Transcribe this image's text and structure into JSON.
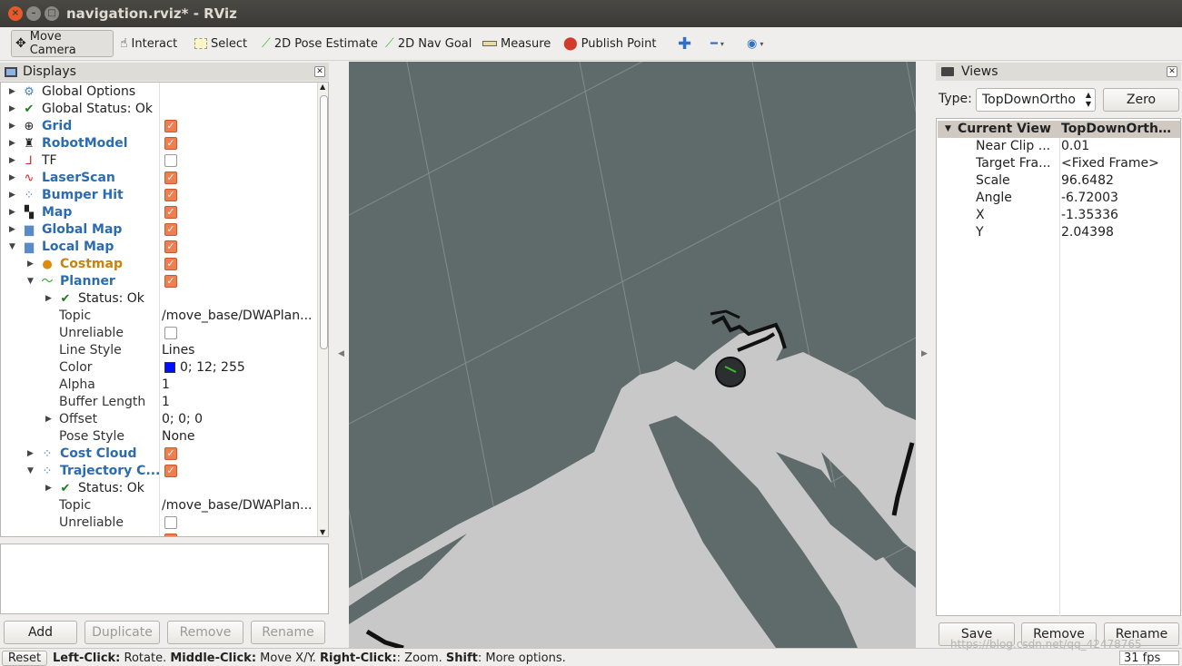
{
  "window": {
    "title": "navigation.rviz* - RViz"
  },
  "toolbar": {
    "move_camera": "Move Camera",
    "interact": "Interact",
    "select": "Select",
    "pose_estimate": "2D Pose Estimate",
    "nav_goal": "2D Nav Goal",
    "measure": "Measure",
    "publish_point": "Publish Point"
  },
  "displays": {
    "title": "Displays",
    "rows": [
      {
        "label": "Global Options"
      },
      {
        "label": "Global Status: Ok"
      },
      {
        "label": "Grid"
      },
      {
        "label": "RobotModel"
      },
      {
        "label": "TF"
      },
      {
        "label": "LaserScan"
      },
      {
        "label": "Bumper Hit"
      },
      {
        "label": "Map"
      },
      {
        "label": "Global Map"
      },
      {
        "label": "Local Map"
      },
      {
        "label": "Costmap"
      },
      {
        "label": "Planner"
      },
      {
        "label": "Status: Ok"
      },
      {
        "label": "Topic",
        "value": "/move_base/DWAPlan..."
      },
      {
        "label": "Unreliable"
      },
      {
        "label": "Line Style",
        "value": "Lines"
      },
      {
        "label": "Color",
        "value": "0; 12; 255"
      },
      {
        "label": "Alpha",
        "value": "1"
      },
      {
        "label": "Buffer Length",
        "value": "1"
      },
      {
        "label": "Offset",
        "value": "0; 0; 0"
      },
      {
        "label": "Pose Style",
        "value": "None"
      },
      {
        "label": "Cost Cloud"
      },
      {
        "label": "Trajectory C..."
      },
      {
        "label": "Status: Ok"
      },
      {
        "label": "Topic",
        "value": "/move_base/DWAPlan..."
      },
      {
        "label": "Unreliable"
      }
    ],
    "planner_color": "#000cff",
    "buttons": {
      "add": "Add",
      "duplicate": "Duplicate",
      "remove": "Remove",
      "rename": "Rename"
    }
  },
  "views": {
    "title": "Views",
    "type_label": "Type:",
    "type_value": "TopDownOrtho",
    "zero": "Zero",
    "header_key": "Current View",
    "header_value": "TopDownOrtho ...",
    "props": [
      {
        "key": "Near Clip ...",
        "value": "0.01"
      },
      {
        "key": "Target Fra...",
        "value": "<Fixed Frame>"
      },
      {
        "key": "Scale",
        "value": "96.6482"
      },
      {
        "key": "Angle",
        "value": "-6.72003"
      },
      {
        "key": "X",
        "value": "-1.35336"
      },
      {
        "key": "Y",
        "value": "2.04398"
      }
    ],
    "buttons": {
      "save": "Save",
      "remove": "Remove",
      "rename": "Rename"
    }
  },
  "statusbar": {
    "reset": "Reset",
    "left_click": "Left-Click:",
    "left_text": " Rotate. ",
    "middle_click": "Middle-Click:",
    "middle_text": " Move X/Y. ",
    "right_click": "Right-Click:",
    "right_text": ": Zoom. ",
    "shift": "Shift",
    "shift_text": ": More options.",
    "fps": "31 fps",
    "watermark": "https://blog.csdn.net/qq_42478765"
  },
  "colors": {
    "accent_checkbox": "#ef7e50",
    "viewport_bg": "#5f6b6b",
    "map_free": "#c8c8c8"
  }
}
